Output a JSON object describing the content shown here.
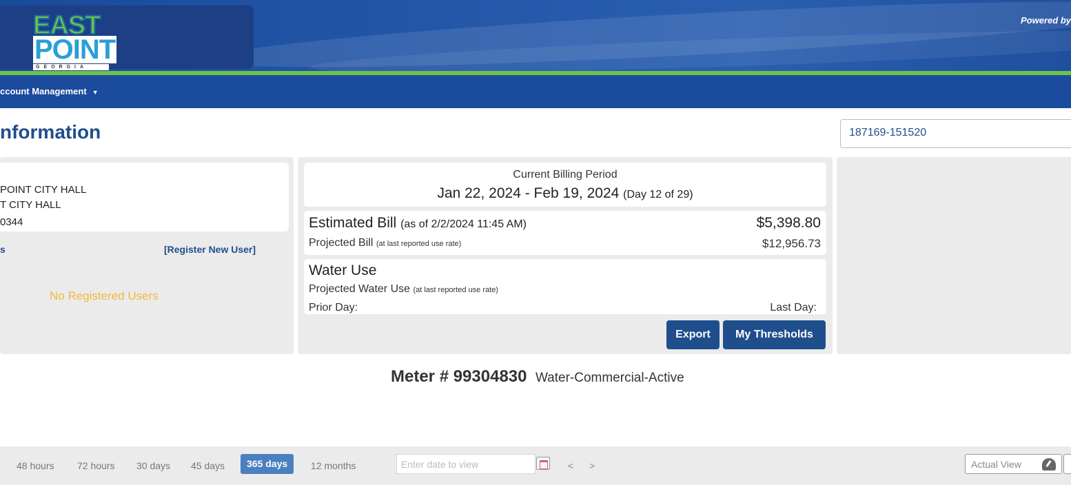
{
  "header": {
    "logo_east": "EAST",
    "logo_point": "POINT",
    "logo_georgia": "GEORGIA",
    "powered_by": "Powered by"
  },
  "nav": {
    "account_management": "ccount Management"
  },
  "page": {
    "title": "nformation",
    "account_number": "187169-151520"
  },
  "customer": {
    "address_lines": [
      "POINT CITY HALL",
      "T CITY HALL",
      "0344"
    ],
    "users_label": "s",
    "register_link": "[Register New User]",
    "no_users": "No Registered Users"
  },
  "billing": {
    "period_label": "Current Billing Period",
    "period_dates": "Jan 22, 2024 - Feb 19, 2024",
    "day_info": "(Day 12 of 29)",
    "estimated_label": "Estimated Bill",
    "estimated_asof": "(as of 2/2/2024 11:45 AM)",
    "estimated_amount": "$5,398.80",
    "projected_label": "Projected Bill",
    "projected_note": "(at last reported use rate)",
    "projected_amount": "$12,956.73"
  },
  "water": {
    "title": "Water Use",
    "projected_label": "Projected Water Use",
    "projected_note": "(at last reported use rate)",
    "prior_day": "Prior Day:",
    "last_day": "Last Day:"
  },
  "buttons": {
    "export": "Export",
    "thresholds": "My Thresholds"
  },
  "meter": {
    "number": "Meter # 99304830",
    "type": "Water-Commercial-Active"
  },
  "toolbar": {
    "ranges": [
      "48 hours",
      "72 hours",
      "30 days",
      "45 days",
      "365 days",
      "12 months"
    ],
    "active_range": "365 days",
    "date_placeholder": "Enter date to view",
    "prev": "<",
    "next": ">",
    "actual_view": "Actual View"
  },
  "colors": {
    "brand_blue": "#1f4e8c",
    "nav_blue": "#1b4b9c",
    "accent_green": "#6cc24a",
    "warning_yellow": "#f0b840",
    "active_range": "#4a7fc0"
  }
}
